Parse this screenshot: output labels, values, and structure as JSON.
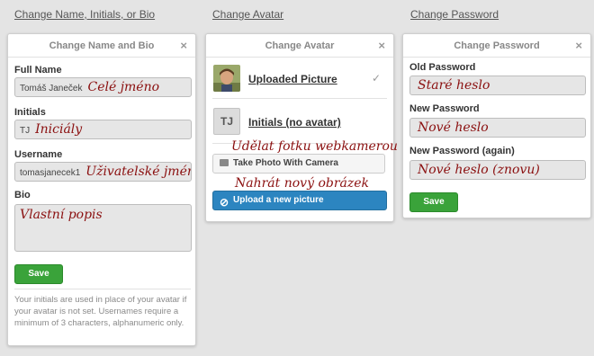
{
  "top_links": {
    "name": "Change Name, Initials, or Bio",
    "avatar": "Change Avatar",
    "password": "Change Password"
  },
  "name_panel": {
    "title": "Change Name and Bio",
    "close": "×",
    "full_name_label": "Full Name",
    "full_name_value": "Tomáš Janeček",
    "full_name_note": "Celé jméno",
    "initials_label": "Initials",
    "initials_value": "TJ",
    "initials_note": "Iniciály",
    "username_label": "Username",
    "username_value": "tomasjanecek1",
    "username_note": "Uživatelské jméno",
    "bio_label": "Bio",
    "bio_note": "Vlastní popis",
    "save": "Save",
    "help": "Your initials are used in place of your avatar if your avatar is not set. Usernames require a minimum of 3 characters, alphanumeric only."
  },
  "avatar_panel": {
    "title": "Change Avatar",
    "close": "×",
    "uploaded": "Uploaded Picture",
    "check": "✓",
    "initials_box": "TJ",
    "initials_option": "Initials (no avatar)",
    "webcam_note": "Udělat fotku webkamerou",
    "take_photo": "Take Photo With Camera",
    "upload_note": "Nahrát nový obrázek",
    "upload": "Upload a new picture"
  },
  "password_panel": {
    "title": "Change Password",
    "close": "×",
    "old_label": "Old Password",
    "old_note": "Staré heslo",
    "new_label": "New Password",
    "new_note": "Nové heslo",
    "again_label": "New Password (again)",
    "again_note": "Nové heslo (znovu)",
    "save": "Save"
  }
}
